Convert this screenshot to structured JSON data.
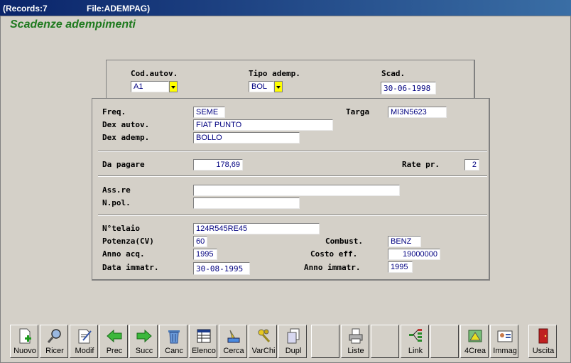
{
  "titlebar": {
    "records": "(Records:7",
    "file": "File:ADEMPAG)"
  },
  "heading": "Scadenze adempimenti",
  "top": {
    "cod_autov_label": "Cod.autov.",
    "cod_autov_value": "A1",
    "tipo_adem_label": "Tipo ademp.",
    "tipo_adem_value": "BOL",
    "scad_label": "Scad.",
    "scad_value": "30-06-1998"
  },
  "form": {
    "freq_label": "Freq.",
    "freq_value": "SEME",
    "targa_label": "Targa",
    "targa_value": "MI3N5623",
    "dex_autov_label": "Dex autov.",
    "dex_autov_value": "FIAT PUNTO",
    "dex_ademp_label": "Dex ademp.",
    "dex_ademp_value": "BOLLO",
    "da_pagare_label": "Da pagare",
    "da_pagare_value": "178,69",
    "rate_pr_label": "Rate pr.",
    "rate_pr_value": "2",
    "assre_label": "Ass.re",
    "assre_value": "",
    "npol_label": "N.pol.",
    "npol_value": "",
    "telaio_label": "N°telaio",
    "telaio_value": "124R545RE45",
    "potenza_label": "Potenza(CV)",
    "potenza_value": "60",
    "combust_label": "Combust.",
    "combust_value": "BENZ",
    "anno_acq_label": "Anno acq.",
    "anno_acq_value": "1995",
    "costo_label": "Costo eff.",
    "costo_value": "19000000",
    "data_immatr_label": "Data immatr.",
    "data_immatr_value": "30-08-1995",
    "anno_immatr_label": "Anno immatr.",
    "anno_immatr_value": "1995"
  },
  "toolbar": [
    {
      "label": "Nuovo",
      "icon": "new-document-icon"
    },
    {
      "label": "Ricer",
      "icon": "magnifier-icon"
    },
    {
      "label": "Modif",
      "icon": "edit-document-icon"
    },
    {
      "label": "Prec",
      "icon": "arrow-left-icon"
    },
    {
      "label": "Succ",
      "icon": "arrow-right-icon"
    },
    {
      "label": "Canc",
      "icon": "trash-icon"
    },
    {
      "label": "Elenco",
      "icon": "list-table-icon"
    },
    {
      "label": "Cerca",
      "icon": "search-brush-icon"
    },
    {
      "label": "VarChi",
      "icon": "keys-icon"
    },
    {
      "label": "Dupl",
      "icon": "duplicate-icon"
    },
    {
      "label": "",
      "icon": ""
    },
    {
      "label": "Liste",
      "icon": "printer-icon"
    },
    {
      "label": "",
      "icon": ""
    },
    {
      "label": "Link",
      "icon": "link-icon"
    },
    {
      "label": "",
      "icon": ""
    },
    {
      "label": "4Crea",
      "icon": "create-icon"
    },
    {
      "label": "Immag",
      "icon": "image-card-icon"
    },
    {
      "label": "Uscita",
      "icon": "exit-door-icon"
    }
  ]
}
